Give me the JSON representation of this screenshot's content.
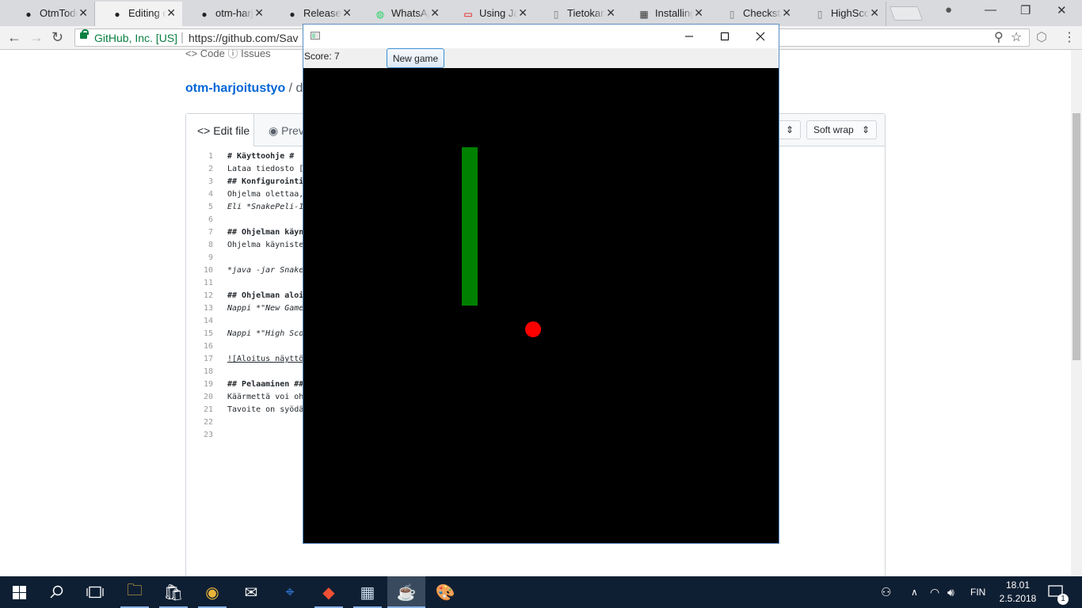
{
  "browser": {
    "tabs": [
      {
        "title": "OtmTodoApp",
        "icon": "github-icon",
        "active": false
      },
      {
        "title": "Editing otm-harjoitustyo",
        "icon": "github-icon",
        "active": true
      },
      {
        "title": "otm-harjoitustyo",
        "icon": "github-icon",
        "active": false
      },
      {
        "title": "Releases",
        "icon": "github-icon",
        "active": false
      },
      {
        "title": "WhatsApp",
        "icon": "whatsapp-icon",
        "active": false
      },
      {
        "title": "Using JavaFX",
        "icon": "oracle-icon",
        "active": false
      },
      {
        "title": "Tietokanta",
        "icon": "document-icon",
        "active": false
      },
      {
        "title": "Installing",
        "icon": "site-icon",
        "active": false
      },
      {
        "title": "Checkstyle",
        "icon": "document-icon",
        "active": false
      },
      {
        "title": "HighScore",
        "icon": "document-icon",
        "active": false
      }
    ],
    "address": {
      "org": "GitHub, Inc. [US]",
      "url": "https://github.com/Sav"
    },
    "glyphs": {
      "back": "←",
      "forward": "→",
      "reload": "↻",
      "close": "✕",
      "minimize": "—",
      "restore": "❐",
      "account": "●",
      "search": "⚲",
      "star": "☆",
      "menu": "⋮",
      "extension": "⬡"
    }
  },
  "github": {
    "nav_fragment": "<> Code    ⓘ Issues",
    "repo": "otm-harjoitustyo",
    "path_sep": " / d",
    "edit_tab": "<> Edit file",
    "preview_tab": "◉ Prev",
    "indent_select": "",
    "wrap_select": "Soft wrap",
    "lines": [
      {
        "n": "1",
        "t": "# Käyttoohje #",
        "s": "h"
      },
      {
        "n": "2",
        "t": "Lataa tiedosto [j",
        "s": ""
      },
      {
        "n": "3",
        "t": "## Konfigurointi",
        "s": "h"
      },
      {
        "n": "4",
        "t": "Ohjelma olettaa,",
        "s": ""
      },
      {
        "n": "5",
        "t": "Eli *SnakePeli-1",
        "s": "i"
      },
      {
        "n": "6",
        "t": "",
        "s": ""
      },
      {
        "n": "7",
        "t": "## Ohjelman käynn",
        "s": "h"
      },
      {
        "n": "8",
        "t": "Ohjelma käyniste",
        "s": ""
      },
      {
        "n": "9",
        "t": "",
        "s": ""
      },
      {
        "n": "10",
        "t": "*java -jar Snake",
        "s": "i"
      },
      {
        "n": "11",
        "t": "",
        "s": ""
      },
      {
        "n": "12",
        "t": "## Ohjelman aloit",
        "s": "h"
      },
      {
        "n": "13",
        "t": "Nappi *\"New Game",
        "s": "i"
      },
      {
        "n": "14",
        "t": "",
        "s": ""
      },
      {
        "n": "15",
        "t": "Nappi *\"High Scor",
        "s": "i"
      },
      {
        "n": "16",
        "t": "",
        "s": ""
      },
      {
        "n": "17",
        "t": "![Aloitus näyttö",
        "s": "u"
      },
      {
        "n": "18",
        "t": "",
        "s": ""
      },
      {
        "n": "19",
        "t": "## Pelaaminen ##",
        "s": "h"
      },
      {
        "n": "20",
        "t": "Käärmettä voi oh",
        "s": ""
      },
      {
        "n": "21",
        "t": "Tavoite on syödä",
        "s": ""
      },
      {
        "n": "22",
        "t": "",
        "s": ""
      },
      {
        "n": "23",
        "t": "",
        "s": ""
      }
    ]
  },
  "game": {
    "window_title": "",
    "score_label": "Score: 7",
    "new_game_label": "New game",
    "snake_color": "#008000",
    "food_color": "#ff0000",
    "board_color": "#000000"
  },
  "taskbar": {
    "apps": [
      {
        "name": "file-explorer-icon",
        "glyph": "🗀",
        "state": "run"
      },
      {
        "name": "store-icon",
        "glyph": "🛍",
        "state": "run"
      },
      {
        "name": "chrome-icon",
        "glyph": "◉",
        "state": "run"
      },
      {
        "name": "mail-icon",
        "glyph": "✉",
        "state": ""
      },
      {
        "name": "maps-icon",
        "glyph": "⌖",
        "state": ""
      },
      {
        "name": "git-icon",
        "glyph": "◆",
        "state": "run"
      },
      {
        "name": "app-window-icon",
        "glyph": "▦",
        "state": "run"
      },
      {
        "name": "java-icon",
        "glyph": "☕",
        "state": "active"
      },
      {
        "name": "paint-icon",
        "glyph": "🎨",
        "state": ""
      }
    ],
    "language": "FIN",
    "time": "18.01",
    "date": "2.5.2018",
    "notification_count": "1"
  }
}
